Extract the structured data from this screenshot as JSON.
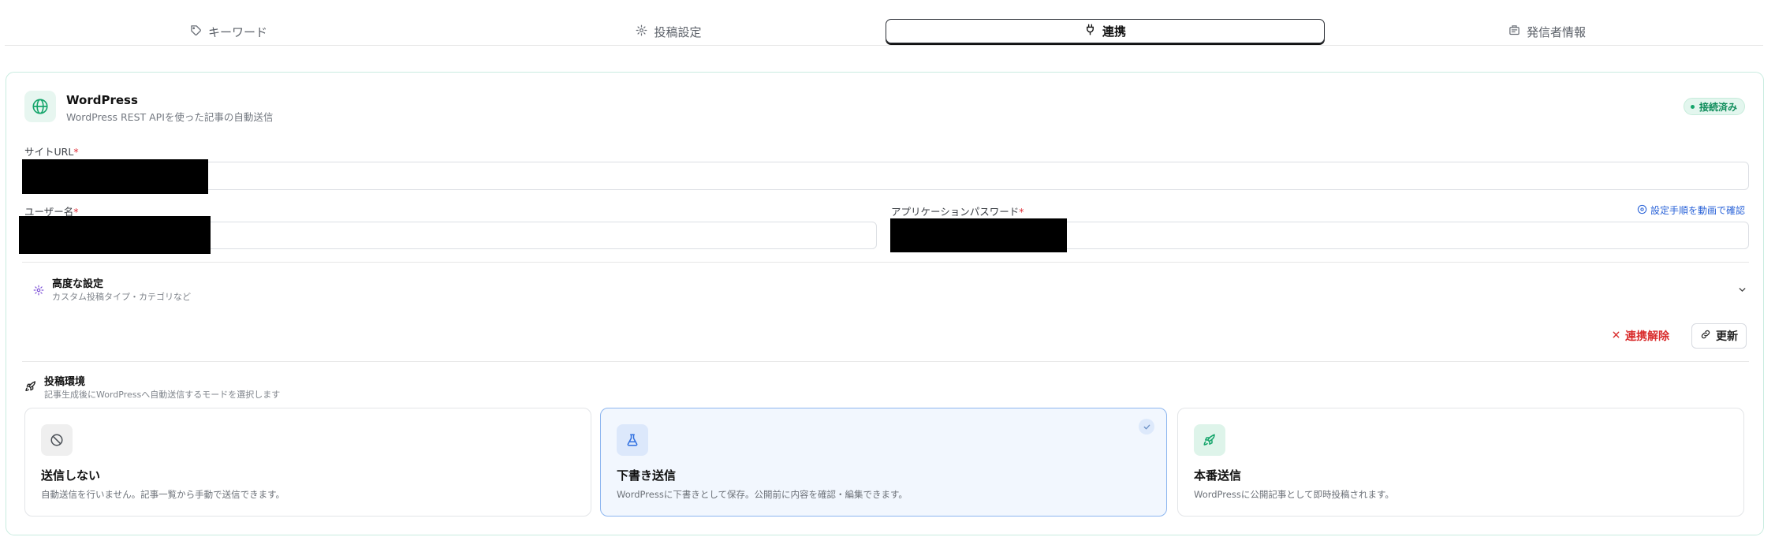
{
  "tabs": [
    {
      "label": "キーワード",
      "icon": "tag-icon"
    },
    {
      "label": "投稿設定",
      "icon": "gear-icon"
    },
    {
      "label": "連携",
      "icon": "plug-icon",
      "active": true
    },
    {
      "label": "発信者情報",
      "icon": "id-card-icon"
    }
  ],
  "integration": {
    "title": "WordPress",
    "subtitle": "WordPress REST APIを使った記事の自動送信",
    "status": "接続済み",
    "status_color": "#0f8d5b",
    "accent_color": "#15a56b"
  },
  "fields": {
    "site_url_label": "サイトURL",
    "site_url_value": "",
    "username_label": "ユーザー名",
    "username_value": "",
    "app_password_label": "アプリケーションパスワード",
    "app_password_value": "",
    "required_mark": "*",
    "help_link": "設定手順を動画で確認"
  },
  "advanced": {
    "title": "高度な設定",
    "subtitle": "カスタム投稿タイプ・カテゴリなど"
  },
  "actions": {
    "disconnect": "連携解除",
    "update": "更新"
  },
  "posting": {
    "title": "投稿環境",
    "subtitle": "記事生成後にWordPressへ自動送信するモードを選択します",
    "modes": [
      {
        "title": "送信しない",
        "desc": "自動送信を行いません。記事一覧から手動で送信できます。",
        "icon": "ban-icon",
        "selected": false
      },
      {
        "title": "下書き送信",
        "desc": "WordPressに下書きとして保存。公開前に内容を確認・編集できます。",
        "icon": "flask-icon",
        "selected": true
      },
      {
        "title": "本番送信",
        "desc": "WordPressに公開記事として即時投稿されます。",
        "icon": "rocket-icon",
        "selected": false
      }
    ]
  }
}
